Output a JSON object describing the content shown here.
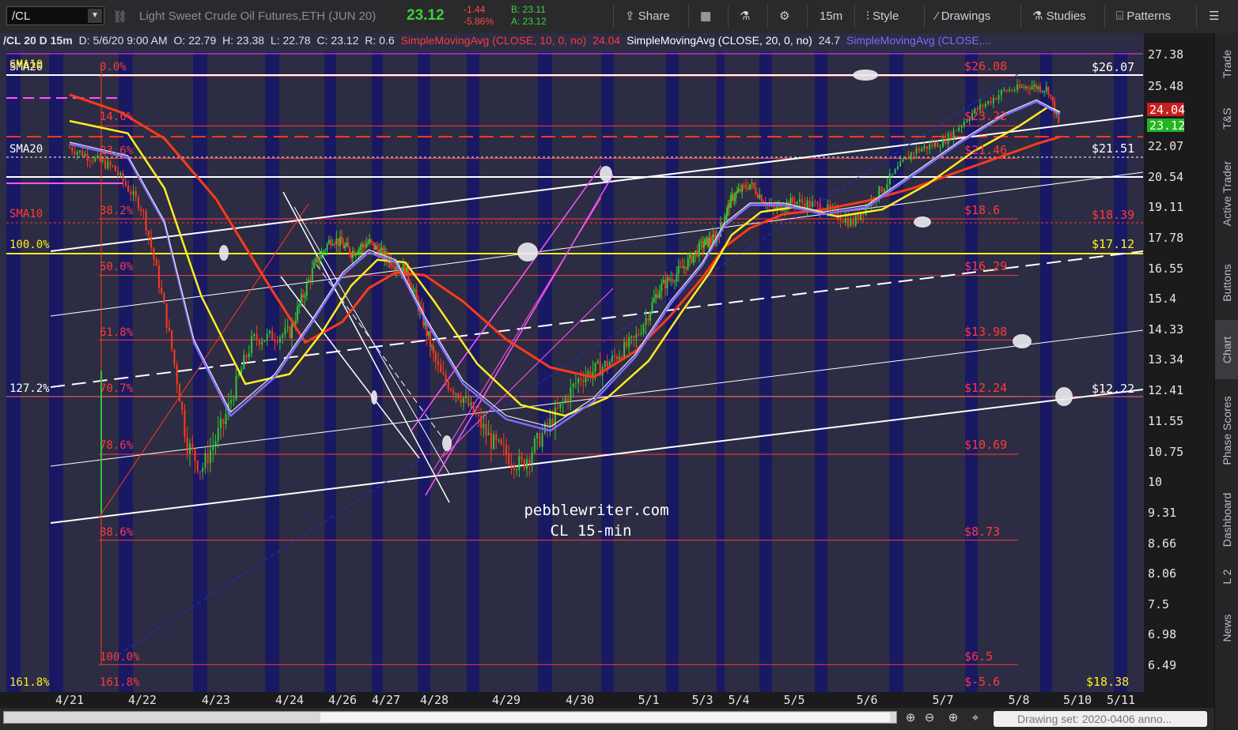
{
  "toolbar": {
    "symbol": "/CL",
    "description": "Light Sweet Crude Oil Futures,ETH (JUN 20)",
    "last": "23.12",
    "change": "-1.44",
    "change_pct": "-5.86%",
    "bid": "B: 23.11",
    "ask": "A: 23.12",
    "share": "Share",
    "timeframe": "15m",
    "style": "Style",
    "drawings": "Drawings",
    "studies": "Studies",
    "patterns": "Patterns"
  },
  "info": {
    "title": "/CL 20 D 15m",
    "date": "D: 5/6/20 9:00 AM",
    "open": "O: 22.79",
    "high": "H: 23.38",
    "low": "L: 22.78",
    "close": "C: 23.12",
    "range": "R: 0.6",
    "sma10": "SimpleMovingAvg (CLOSE, 10, 0, no)",
    "sma10_val": "24.04",
    "sma20": "SimpleMovingAvg (CLOSE, 20, 0, no)",
    "sma20_val": "24.7",
    "sma_other": "SimpleMovingAvg (CLOSE,..."
  },
  "chart_data": {
    "type": "candlestick",
    "title": "/CL 20 D 15m",
    "x_dates": [
      "4/21",
      "4/22",
      "4/23",
      "4/24",
      "4/26",
      "4/27",
      "4/28",
      "4/29",
      "4/30",
      "5/1",
      "5/3",
      "5/4",
      "5/5",
      "5/6",
      "5/7",
      "5/8",
      "5/10",
      "5/11"
    ],
    "y_ticks": [
      "27.38",
      "25.48",
      "24.04",
      "23.12",
      "22.07",
      "20.54",
      "19.11",
      "17.78",
      "16.55",
      "15.4",
      "14.33",
      "13.34",
      "12.41",
      "11.55",
      "10.75",
      "10",
      "9.31",
      "8.66",
      "8.06",
      "7.5",
      "6.98",
      "6.49"
    ],
    "ylim": [
      6.3,
      28.0
    ],
    "price_path": [
      [
        0,
        22.0
      ],
      [
        0.3,
        21.5
      ],
      [
        0.6,
        21.0
      ],
      [
        1.0,
        19.0
      ],
      [
        1.3,
        15.0
      ],
      [
        1.6,
        11.0
      ],
      [
        1.8,
        10.3
      ],
      [
        2.1,
        11.5
      ],
      [
        2.5,
        14.0
      ],
      [
        3.0,
        14.2
      ],
      [
        3.5,
        16.8
      ],
      [
        3.8,
        17.8
      ],
      [
        4.2,
        17.2
      ],
      [
        4.6,
        17.6
      ],
      [
        5.0,
        17.0
      ],
      [
        5.4,
        16.5
      ],
      [
        5.8,
        14.5
      ],
      [
        6.1,
        12.8
      ],
      [
        6.4,
        12.2
      ],
      [
        6.8,
        11.0
      ],
      [
        7.2,
        10.4
      ],
      [
        7.6,
        11.5
      ],
      [
        8.0,
        12.8
      ],
      [
        8.4,
        13.2
      ],
      [
        8.8,
        14.0
      ],
      [
        9.2,
        15.8
      ],
      [
        9.6,
        16.5
      ],
      [
        10.0,
        17.5
      ],
      [
        10.4,
        17.8
      ],
      [
        10.8,
        19.5
      ],
      [
        11.2,
        20.2
      ],
      [
        11.6,
        19.0
      ],
      [
        12.0,
        19.4
      ],
      [
        12.4,
        19.1
      ],
      [
        12.8,
        18.4
      ],
      [
        13.2,
        20.0
      ],
      [
        13.6,
        21.8
      ],
      [
        14.0,
        22.3
      ],
      [
        14.4,
        24.0
      ],
      [
        14.8,
        25.2
      ],
      [
        15.2,
        25.5
      ],
      [
        15.5,
        25.3
      ],
      [
        15.7,
        23.1
      ]
    ],
    "sma10_path": [
      [
        0,
        22.3
      ],
      [
        0.8,
        21.6
      ],
      [
        1.3,
        18.5
      ],
      [
        1.7,
        14.0
      ],
      [
        2.2,
        11.8
      ],
      [
        2.8,
        12.9
      ],
      [
        3.4,
        14.6
      ],
      [
        4.0,
        16.4
      ],
      [
        4.6,
        17.3
      ],
      [
        5.2,
        16.9
      ],
      [
        5.8,
        14.8
      ],
      [
        6.4,
        12.7
      ],
      [
        7.0,
        11.7
      ],
      [
        7.6,
        11.4
      ],
      [
        8.2,
        12.2
      ],
      [
        8.8,
        13.5
      ],
      [
        9.4,
        15.3
      ],
      [
        10.0,
        16.8
      ],
      [
        10.6,
        18.4
      ],
      [
        11.2,
        19.3
      ],
      [
        11.8,
        19.3
      ],
      [
        12.4,
        18.9
      ],
      [
        13.0,
        19.2
      ],
      [
        13.6,
        20.7
      ],
      [
        14.2,
        22.3
      ],
      [
        14.8,
        23.9
      ],
      [
        15.3,
        24.7
      ],
      [
        15.7,
        24.0
      ]
    ],
    "sma20_path": [
      [
        0,
        23.5
      ],
      [
        0.8,
        22.8
      ],
      [
        1.3,
        20.0
      ],
      [
        1.8,
        15.5
      ],
      [
        2.4,
        12.6
      ],
      [
        3.0,
        12.9
      ],
      [
        3.6,
        14.2
      ],
      [
        4.2,
        15.9
      ],
      [
        4.8,
        16.9
      ],
      [
        5.4,
        16.8
      ],
      [
        6.0,
        15.3
      ],
      [
        6.6,
        13.2
      ],
      [
        7.2,
        12.0
      ],
      [
        7.8,
        11.7
      ],
      [
        8.4,
        12.2
      ],
      [
        9.0,
        13.3
      ],
      [
        9.6,
        14.9
      ],
      [
        10.2,
        16.4
      ],
      [
        10.8,
        17.9
      ],
      [
        11.4,
        18.9
      ],
      [
        12.0,
        19.1
      ],
      [
        12.6,
        18.7
      ],
      [
        13.2,
        19.0
      ],
      [
        13.8,
        20.2
      ],
      [
        14.4,
        21.8
      ],
      [
        15.0,
        23.2
      ],
      [
        15.5,
        24.3
      ],
      [
        15.7,
        24.0
      ]
    ],
    "sma50_path": [
      [
        0,
        25.0
      ],
      [
        0.7,
        24.0
      ],
      [
        1.3,
        22.5
      ],
      [
        2.0,
        19.5
      ],
      [
        2.7,
        16.0
      ],
      [
        3.3,
        13.9
      ],
      [
        4.0,
        14.6
      ],
      [
        4.6,
        15.8
      ],
      [
        5.2,
        16.4
      ],
      [
        5.8,
        16.3
      ],
      [
        6.4,
        15.3
      ],
      [
        7.0,
        14.0
      ],
      [
        7.6,
        13.1
      ],
      [
        8.2,
        12.8
      ],
      [
        8.8,
        13.6
      ],
      [
        9.4,
        14.8
      ],
      [
        10.0,
        16.2
      ],
      [
        10.6,
        17.4
      ],
      [
        11.2,
        18.2
      ],
      [
        11.8,
        18.8
      ],
      [
        12.4,
        19.0
      ],
      [
        13.0,
        19.4
      ],
      [
        13.6,
        20.0
      ],
      [
        14.2,
        20.8
      ],
      [
        14.8,
        21.6
      ],
      [
        15.3,
        22.2
      ],
      [
        15.7,
        22.6
      ]
    ],
    "fib_left_labels": [
      "0.0%",
      "14.6%",
      "23.6%",
      "38.2%",
      "50.0%",
      "61.8%",
      "70.7%",
      "78.6%",
      "88.6%",
      "100.0%",
      "161.8%"
    ],
    "fib_right_prices": [
      "$26.08",
      "$23.22",
      "$21.46",
      "$18.6",
      "$16.29",
      "$13.98",
      "$12.24",
      "$10.69",
      "$8.73",
      "$6.5",
      "$-5.6"
    ],
    "fib_values": [
      26.08,
      23.22,
      21.46,
      18.6,
      16.29,
      13.98,
      12.24,
      10.69,
      8.73,
      6.5
    ],
    "left_labels": [
      "SMA20",
      "SMA10",
      "100.0%",
      "127.2%",
      "161.8%",
      "SMA20",
      "SMA10"
    ],
    "right_labels": [
      "$26.07",
      "$21.51",
      "$18.39",
      "$17.12",
      "$12.22",
      "$18.38"
    ],
    "price_tags": [
      "24.04",
      "23.12"
    ],
    "watermark_1": "pebblewriter.com",
    "watermark_2": "CL 15-min",
    "colors": {
      "fib": "#ff3a3a",
      "sma10": "#e8e8e8",
      "sma20": "#7f6bff",
      "sma50": "#ffee22",
      "sma100": "#ff3a1a",
      "session_dark": "#191963",
      "session_light": "#434467"
    }
  },
  "right_tabs": [
    "Trade",
    "T&S",
    "Active Trader",
    "Buttons",
    "Chart",
    "Phase Scores",
    "Dashboard",
    "L 2",
    "News"
  ],
  "bottom": {
    "drawing_set": "Drawing set: 2020-0406 anno..."
  }
}
